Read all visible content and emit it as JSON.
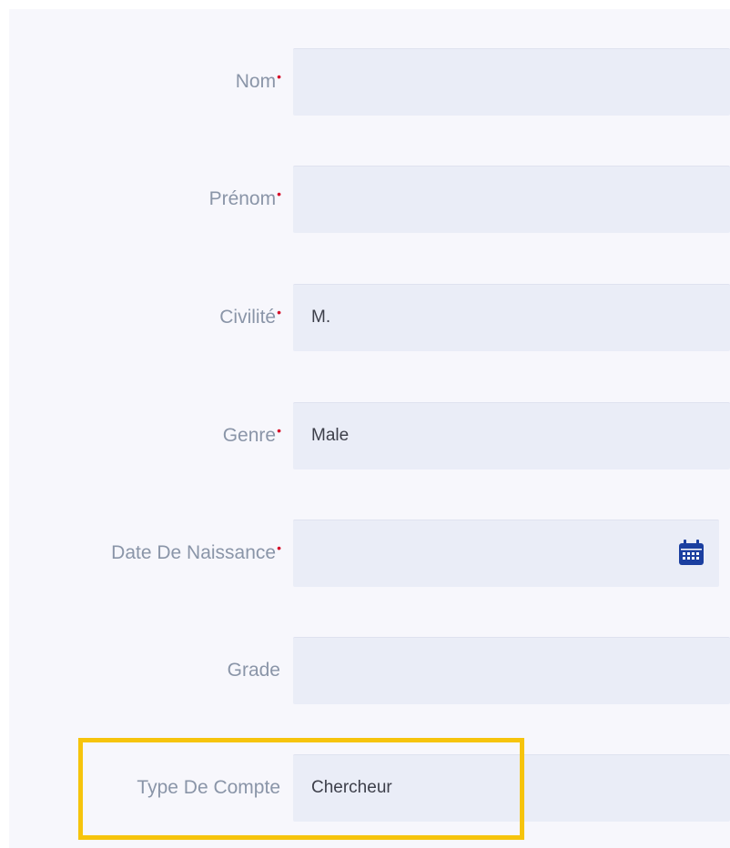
{
  "form": {
    "fields": [
      {
        "label": "Nom",
        "required": "•",
        "value": ""
      },
      {
        "label": "Prénom",
        "required": "•",
        "value": ""
      },
      {
        "label": "Civilité",
        "required": "•",
        "value": "M."
      },
      {
        "label": "Genre",
        "required": "•",
        "value": "Male"
      },
      {
        "label": "Date De Naissance",
        "required": "•",
        "value": "",
        "icon": "calendar-icon"
      },
      {
        "label": "Grade",
        "required": "",
        "value": ""
      },
      {
        "label": "Type De Compte",
        "required": "",
        "value": "Chercheur"
      }
    ]
  },
  "colors": {
    "highlight": "#f6c40c",
    "required_marker": "#d6102a",
    "field_bg": "#eaedf7",
    "calendar_icon": "#1b3fa0"
  }
}
